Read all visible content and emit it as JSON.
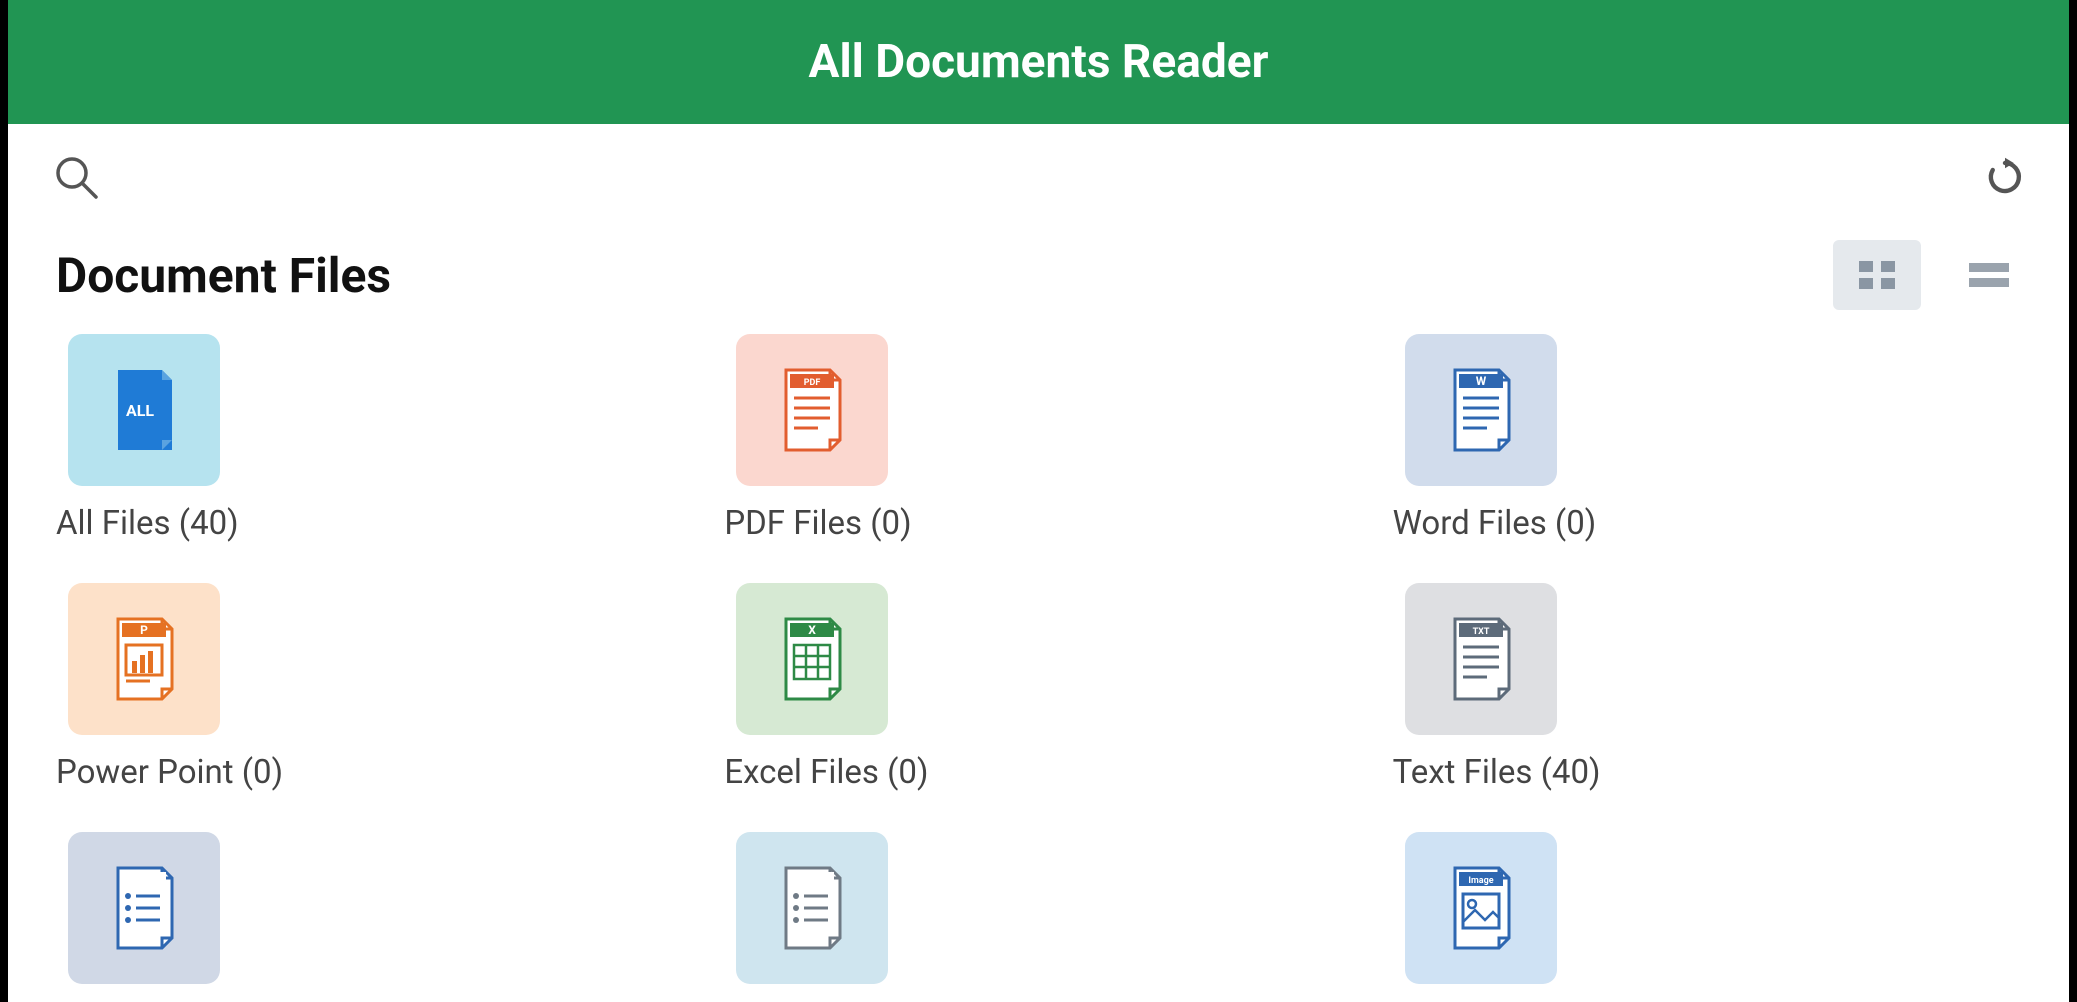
{
  "header": {
    "title": "All Documents Reader"
  },
  "section": {
    "title": "Document Files"
  },
  "view": {
    "mode": "grid"
  },
  "categories": [
    {
      "id": "all",
      "label": "All Files (40)",
      "badge": "ALL",
      "bg": "bg-all",
      "stroke": "#1f7bd6",
      "fill": "#1f7bd6",
      "badgeFill": "#1f7bd6",
      "badgeText": "#ffffff",
      "style": "solid"
    },
    {
      "id": "pdf",
      "label": "PDF Files (0)",
      "badge": "PDF",
      "bg": "bg-pdf",
      "stroke": "#e25d2f",
      "fill": "#ffffff",
      "badgeFill": "#e25d2f",
      "badgeText": "#ffffff",
      "style": "lines"
    },
    {
      "id": "word",
      "label": "Word Files (0)",
      "badge": "W",
      "bg": "bg-word",
      "stroke": "#2e67b1",
      "fill": "#ffffff",
      "badgeFill": "#2e67b1",
      "badgeText": "#ffffff",
      "style": "lines"
    },
    {
      "id": "ppt",
      "label": "Power Point (0)",
      "badge": "P",
      "bg": "bg-ppt",
      "stroke": "#e57122",
      "fill": "#ffffff",
      "badgeFill": "#e57122",
      "badgeText": "#ffffff",
      "style": "chart"
    },
    {
      "id": "xls",
      "label": "Excel Files (0)",
      "badge": "X",
      "bg": "bg-xls",
      "stroke": "#2e8a46",
      "fill": "#ffffff",
      "badgeFill": "#2e8a46",
      "badgeText": "#ffffff",
      "style": "table"
    },
    {
      "id": "txt",
      "label": "Text Files (40)",
      "badge": "TXT",
      "bg": "bg-txt",
      "stroke": "#5d6b7a",
      "fill": "#ffffff",
      "badgeFill": "#5d6b7a",
      "badgeText": "#ffffff",
      "style": "lines"
    },
    {
      "id": "rtf",
      "label": "",
      "badge": "",
      "bg": "bg-rtf",
      "stroke": "#2e67b1",
      "fill": "#ffffff",
      "badgeFill": "#ffffff",
      "badgeText": "#2e67b1",
      "style": "bullets"
    },
    {
      "id": "csv",
      "label": "",
      "badge": "",
      "bg": "bg-csv",
      "stroke": "#6f7a85",
      "fill": "#ffffff",
      "badgeFill": "#ffffff",
      "badgeText": "#6f7a85",
      "style": "bullets"
    },
    {
      "id": "img",
      "label": "",
      "badge": "Image",
      "bg": "bg-img",
      "stroke": "#2e67b1",
      "fill": "#ffffff",
      "badgeFill": "#2e67b1",
      "badgeText": "#ffffff",
      "style": "image"
    }
  ],
  "icons": {
    "search": "search-icon",
    "refresh": "refresh-icon",
    "grid": "grid-view-icon",
    "list": "list-view-icon"
  }
}
